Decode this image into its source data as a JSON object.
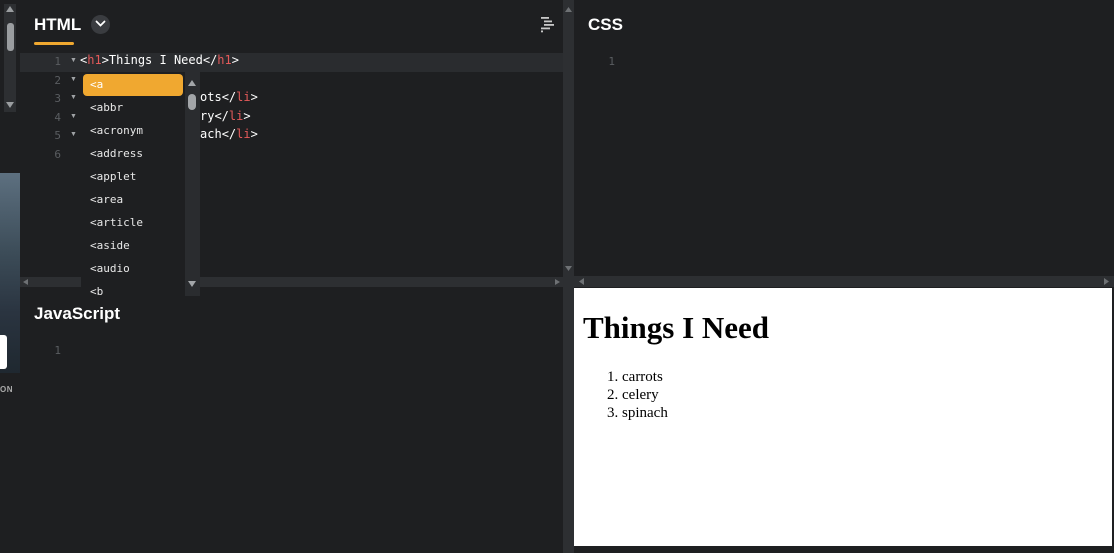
{
  "html_panel": {
    "title": "HTML",
    "line_numbers": [
      "1",
      "2",
      "3",
      "4",
      "5",
      "6"
    ],
    "line1": {
      "open_bracket": "<",
      "tag": "h1",
      "close_bracket": ">",
      "text": "Things I Need",
      "end_open": "</",
      "end_tag": "h1",
      "end_close": ">"
    },
    "line3_visible": {
      "text": "ots",
      "end_open": "</",
      "end_tag": "li",
      "end_close": ">"
    },
    "line4_visible": {
      "text": "ry",
      "end_open": "</",
      "end_tag": "li",
      "end_close": ">"
    },
    "line5_visible": {
      "text": "ach",
      "end_open": "</",
      "end_tag": "li",
      "end_close": ">"
    },
    "autocomplete": [
      "<a",
      "<abbr",
      "<acronym",
      "<address",
      "<applet",
      "<area",
      "<article",
      "<aside",
      "<audio",
      "<b"
    ],
    "autocomplete_selected": "<a"
  },
  "css_panel": {
    "title": "CSS",
    "line_numbers": [
      "1"
    ]
  },
  "js_panel": {
    "title": "JavaScript",
    "line_numbers": [
      "1"
    ]
  },
  "preview": {
    "heading": "Things I Need",
    "items": [
      "carrots",
      "celery",
      "spinach"
    ]
  },
  "left_strip": {
    "text": "ON"
  },
  "colors": {
    "accent": "#f0a830",
    "tag": "#e45a5a",
    "panel_bg": "#1e1f21"
  },
  "icons": {
    "dropdown": "chevron-down-icon",
    "format": "format-icon"
  }
}
